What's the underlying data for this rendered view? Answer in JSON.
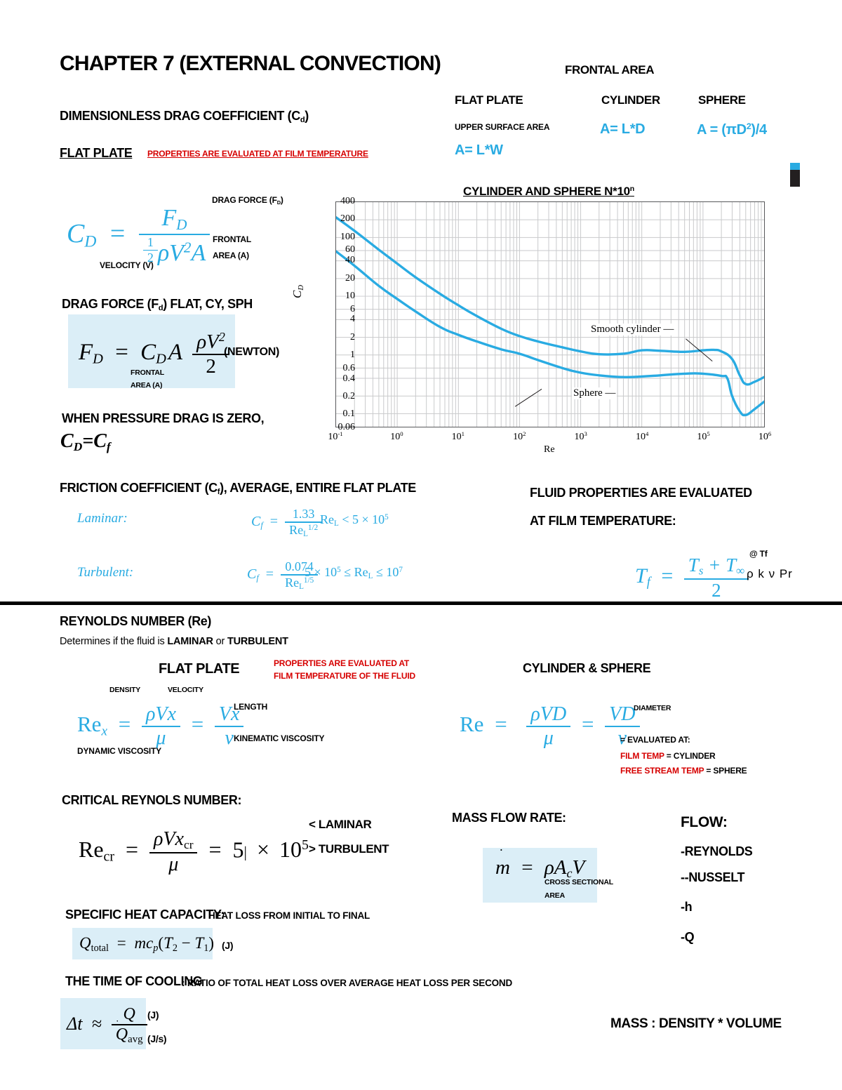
{
  "page": {
    "title": "CHAPTER 7 (EXTERNAL CONVECTION)"
  },
  "drag_coefficient": {
    "heading": "DIMENSIONLESS DRAG COEFFICIENT (C",
    "heading_sub": "d",
    "heading_close": ")",
    "flat_plate_label": "FLAT PLATE",
    "properties_note": "PROPERTIES ARE EVALUATED AT FILM TEMPERATURE",
    "cd_lhs": "C",
    "cd_lhs_sub": "D",
    "eq": "=",
    "numerator": "F",
    "numerator_sub": "D",
    "den_half_num": "1",
    "den_half_den": "2",
    "den_rest": "ρV",
    "den_exp": "2",
    "den_area": "A",
    "ann_drag_force": "DRAG FORCE (F",
    "ann_drag_force_sub": "D",
    "ann_drag_force_close": ")",
    "ann_frontal": "FRONTAL",
    "ann_area": "AREA (A)",
    "ann_velocity": "VELOCITY (V)"
  },
  "frontal_area": {
    "title": "FRONTAL AREA",
    "columns": [
      {
        "name": "FLAT PLATE",
        "note": "UPPER SURFACE AREA",
        "formula": "A= L*W"
      },
      {
        "name": "CYLINDER",
        "note": "",
        "formula": "A= L*D"
      },
      {
        "name": "SPHERE",
        "note": "",
        "formula_pre": "A = (πD",
        "formula_sup": "2",
        "formula_post": ")/4"
      }
    ]
  },
  "drag_force": {
    "heading_pre": "DRAG FORCE (F",
    "heading_sub": "d",
    "heading_post": ") FLAT, CY, SPH",
    "lhs": "F",
    "lhs_sub": "D",
    "eq": "=",
    "cd": "C",
    "cd_sub": "D",
    "a": "A",
    "frac_num_pre": "ρV",
    "frac_num_sup": "2",
    "frac_den": "2",
    "unit": "(NEWTON)",
    "ann_frontal": "FRONTAL",
    "ann_area": "AREA (A)"
  },
  "pressure_drag": {
    "note": "WHEN PRESSURE DRAG IS ZERO,",
    "formula_pre": "C",
    "formula_sub1": "D",
    "formula_eq": "=C",
    "formula_sub2": "f"
  },
  "friction": {
    "heading_pre": "FRICTION COEFFICIENT (C",
    "heading_sub": "f",
    "heading_post": "), AVERAGE, ENTIRE FLAT PLATE",
    "rows": [
      {
        "regime": "Laminar:",
        "cf": "C",
        "cf_sub": "f",
        "eq": "=",
        "num": "1.33",
        "den": "Re",
        "den_sub": "L",
        "den_sup": "1/2",
        "cond_pre": "Re",
        "cond_sub": "L",
        "cond_post": " < 5 × 10",
        "cond_sup": "5"
      },
      {
        "regime": "Turbulent:",
        "cf": "C",
        "cf_sub": "f",
        "eq": "=",
        "num": "0.074",
        "den": "Re",
        "den_sub": "L",
        "den_sup": "1/5",
        "cond_pre": "5 × 10",
        "cond_presup": "5",
        "cond_mid": " ≤ Re",
        "cond_sub": "L",
        "cond_post": " ≤ 10",
        "cond_sup": "7"
      }
    ]
  },
  "fluid_properties": {
    "line1": "FLUID PROPERTIES ARE EVALUATED",
    "line2": "AT FILM TEMPERATURE:",
    "tf": "T",
    "tf_sub": "f",
    "eq": "=",
    "num_ts": "T",
    "num_ts_sub": "s",
    "num_plus": "+",
    "num_tinf": "T",
    "num_tinf_sub": "∞",
    "den": "2",
    "at_tf": "@ Tf",
    "props": "ρ k ν  Pr"
  },
  "reynolds": {
    "heading": "REYNOLDS NUMBER (Re)",
    "subtitle_pre": "Determines if the fluid is ",
    "subtitle_laminar": "LAMINAR",
    "subtitle_or": " or ",
    "subtitle_turbulent": "TURBULENT",
    "flat_plate_label": "FLAT PLATE",
    "props_note_l1": "PROPERTIES ARE EVALUATED AT",
    "props_note_l2": "FILM TEMPERATURE OF THE FLUID",
    "re_lhs": "Re",
    "re_lhs_sub": "x",
    "eq1": "=",
    "num1": "ρVx",
    "den1": "μ",
    "eq2": "=",
    "num2": "Vx",
    "den2": "ν",
    "ann_density": "DENSITY",
    "ann_velocity": "VELOCITY",
    "ann_length": "LENGTH",
    "ann_kinematic": "KINEMATIC VISCOSITY",
    "ann_dynamic": "DYNAMIC VISCOSITY"
  },
  "cyl_sphere_re": {
    "label": "CYLINDER & SPHERE",
    "re_lhs": "Re",
    "eq1": "=",
    "num1": "ρVD",
    "den1": "μ",
    "eq2": "=",
    "num2": "VD",
    "den2": "ν",
    "ann_diameter": "DIAMETER",
    "evaluated_at": "= EVALUATED AT:",
    "film_temp": "FILM TEMP",
    "film_temp_post": " = CYLINDER",
    "free_stream": "FREE STREAM TEMP",
    "free_stream_post": " = SPHERE"
  },
  "critical_re": {
    "heading": "CRITICAL REYNOLS NUMBER:",
    "lhs": "Re",
    "lhs_sub": "cr",
    "eq1": "=",
    "num": "ρVx",
    "num_sub": "cr",
    "den": "μ",
    "eq2": "=",
    "value": "5",
    "times": "×",
    "ten": "10",
    "exp": "5",
    "laminar_note": "< LAMINAR",
    "turbulent_note": "> TURBULENT"
  },
  "mass_flow": {
    "heading": "MASS FLOW RATE:",
    "lhs": "m",
    "eq": "=",
    "rhs_pre": "ρA",
    "rhs_sub": "c",
    "rhs_post": "V",
    "ann1": "CROSS SECTIONAL",
    "ann2": "AREA"
  },
  "flow_list": {
    "heading": "FLOW:",
    "items": [
      "-REYNOLDS",
      "--NUSSELT",
      "-h",
      "-Q"
    ]
  },
  "specific_heat": {
    "heading": "SPECIFIC HEAT CAPACITY:",
    "note": "HEAT LOSS FROM INITIAL TO FINAL",
    "lhs": "Q",
    "lhs_sub": "total",
    "eq": "=",
    "rhs": "mc",
    "rhs_sub": "p",
    "rhs_paren_open": "(",
    "t2": "T",
    "t2_sub": "2",
    "minus": "−",
    "t1": "T",
    "t1_sub": "1",
    "rhs_paren_close": ")",
    "unit": "(J)"
  },
  "cooling_time": {
    "heading": "THE TIME OF COOLING",
    "note": ": RATIO OF TOTAL HEAT LOSS OVER AVERAGE HEAT LOSS PER SECOND",
    "lhs": "Δt",
    "approx": "≈",
    "num": "Q",
    "den": "Q",
    "den_sub": "avg",
    "unit_num": "(J)",
    "unit_den": "(J/s)"
  },
  "mass_note": "MASS : DENSITY * VOLUME",
  "colors": {
    "accent_blue": "#29ABE2",
    "alert_red": "#d60000",
    "highlight_bg": "#dbeef7",
    "chart_curve": "#29ABE2",
    "axis": "#58595b"
  },
  "chart_data": {
    "type": "line",
    "title": "CYLINDER AND SPHERE   N*10",
    "title_sup": "n",
    "xlabel": "Re",
    "ylabel": "C_D",
    "xscale": "log",
    "yscale": "log",
    "xlim": [
      0.1,
      1000000
    ],
    "ylim": [
      0.06,
      400
    ],
    "xticks": [
      "10",
      "10",
      "10",
      "10",
      "10",
      "10",
      "10",
      "10"
    ],
    "xtick_exps": [
      "-1",
      "0",
      "1",
      "2",
      "3",
      "4",
      "5",
      "6"
    ],
    "xtick_values": [
      0.1,
      1,
      10,
      100,
      1000,
      10000,
      100000,
      1000000
    ],
    "yticks": [
      "400",
      "200",
      "100",
      "60",
      "40",
      "20",
      "10",
      "6",
      "4",
      "2",
      "1",
      "0.6",
      "0.4",
      "0.2",
      "0.1",
      "0.06"
    ],
    "ytick_values": [
      400,
      200,
      100,
      60,
      40,
      20,
      10,
      6,
      4,
      2,
      1,
      0.6,
      0.4,
      0.2,
      0.1,
      0.06
    ],
    "grid": true,
    "series": [
      {
        "name": "Smooth cylinder",
        "label_x": 17000,
        "points": [
          [
            0.1,
            220
          ],
          [
            0.2,
            130
          ],
          [
            0.5,
            62
          ],
          [
            1,
            36
          ],
          [
            2,
            21
          ],
          [
            5,
            11
          ],
          [
            10,
            7.0
          ],
          [
            20,
            4.6
          ],
          [
            50,
            2.8
          ],
          [
            100,
            2.1
          ],
          [
            200,
            1.7
          ],
          [
            500,
            1.35
          ],
          [
            1000,
            1.15
          ],
          [
            2000,
            1.03
          ],
          [
            5000,
            1.05
          ],
          [
            10000,
            1.2
          ],
          [
            20000,
            1.18
          ],
          [
            50000,
            1.13
          ],
          [
            100000,
            1.2
          ],
          [
            150000,
            1.22
          ],
          [
            200000,
            1.15
          ],
          [
            300000,
            0.85
          ],
          [
            400000,
            0.45
          ],
          [
            500000,
            0.32
          ],
          [
            700000,
            0.35
          ],
          [
            1000000,
            0.42
          ]
        ]
      },
      {
        "name": "Sphere",
        "label_x": 1500,
        "points": [
          [
            0.1,
            58
          ],
          [
            0.2,
            33
          ],
          [
            0.5,
            15
          ],
          [
            1,
            9.0
          ],
          [
            2,
            5.5
          ],
          [
            5,
            3.0
          ],
          [
            10,
            2.2
          ],
          [
            20,
            1.7
          ],
          [
            50,
            1.25
          ],
          [
            100,
            1.05
          ],
          [
            200,
            0.82
          ],
          [
            500,
            0.6
          ],
          [
            1000,
            0.5
          ],
          [
            2000,
            0.45
          ],
          [
            5000,
            0.42
          ],
          [
            10000,
            0.43
          ],
          [
            20000,
            0.45
          ],
          [
            50000,
            0.48
          ],
          [
            100000,
            0.48
          ],
          [
            200000,
            0.44
          ],
          [
            250000,
            0.4
          ],
          [
            300000,
            0.2
          ],
          [
            400000,
            0.11
          ],
          [
            500000,
            0.095
          ],
          [
            700000,
            0.12
          ],
          [
            1000000,
            0.16
          ]
        ]
      }
    ]
  }
}
